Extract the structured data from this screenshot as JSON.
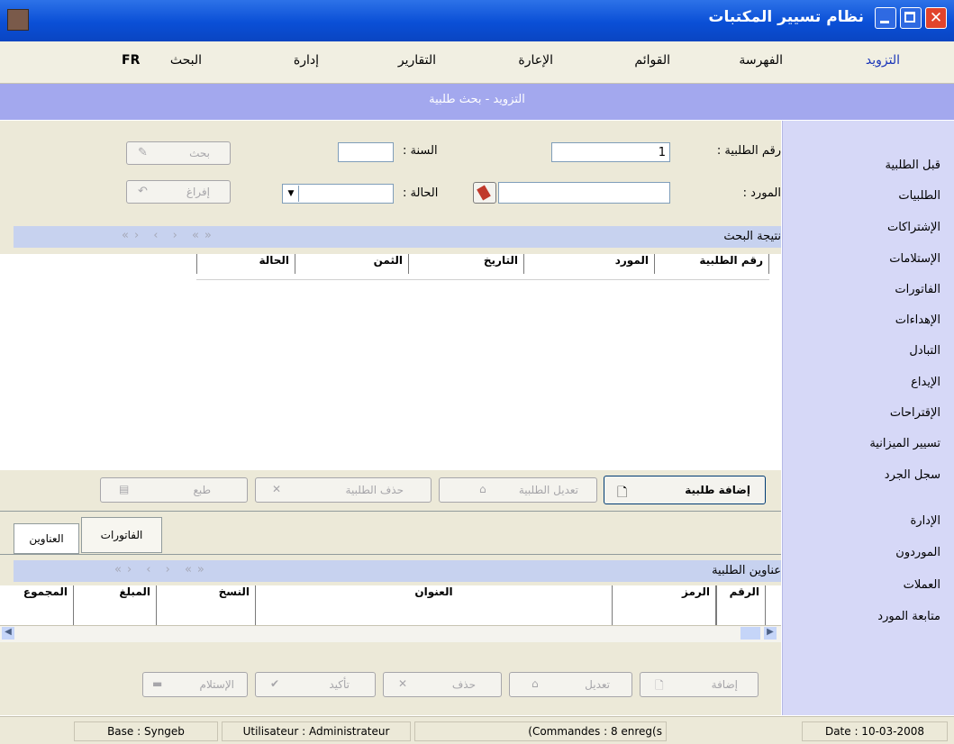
{
  "window": {
    "title": "نظام تسيير المكتبات"
  },
  "menu": {
    "items": [
      "التزويد",
      "الفهرسة",
      "القوائم",
      "الإعارة",
      "التقارير",
      "إدارة",
      "البحث",
      "FR"
    ]
  },
  "header": {
    "title": "التزويد - بحث طلبية"
  },
  "search": {
    "order_no_label": "رقم الطلبية :",
    "order_no_value": "1",
    "year_label": "السنة :",
    "year_value": "",
    "supplier_label": "المورد :",
    "supplier_value": "",
    "status_label": "الحالة :",
    "status_value": "",
    "search_button": "بحث",
    "clear_button": "إفراغ"
  },
  "results": {
    "title": "نتيجة البحث",
    "arrows": "«› ‹ › «»",
    "columns": [
      "رقم الطلبية",
      "المورد",
      "التاريخ",
      "الثمن",
      "الحالة"
    ]
  },
  "order_actions": {
    "add": "إضافة طلبية",
    "edit": "تعديل الطلبية",
    "delete": "حذف الطلبية",
    "print": "طبع"
  },
  "tabs": [
    "العناوين",
    "الفاتورات"
  ],
  "titles_section": {
    "title": "عناوين الطلبية",
    "columns": [
      "الرقم",
      "الرمز",
      "العنوان",
      "النسخ",
      "المبلغ",
      "المجموع"
    ]
  },
  "title_actions": {
    "add": "إضافة",
    "edit": "تعديل",
    "delete": "حذف",
    "confirm": "تأكيد",
    "receive": "الإستلام"
  },
  "sidebar": {
    "items": [
      "قبل الطلبية",
      "الطلبيات",
      "الإشتراكات",
      "الإستلامات",
      "الفاتورات",
      "الإهداءات",
      "التبادل",
      "الإيداع",
      "الإقتراحات",
      "تسيير الميزانية",
      "سجل الجرد",
      "الإدارة",
      "الموردون",
      "العملات",
      "متابعة المورد"
    ]
  },
  "status": {
    "base": "Base : Syngeb",
    "user": "Utilisateur : Administrateur",
    "records": "(Commandes : 8 enreg(s",
    "date": "Date : 10-03-2008"
  },
  "colors": {
    "titlebar": "#0a4fd6",
    "header": "#a3a8ee",
    "sidebar": "#d6d8f7",
    "strip": "#c7d2ef"
  }
}
